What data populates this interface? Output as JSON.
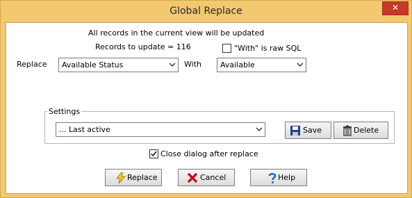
{
  "window": {
    "title": "Global Replace",
    "close_label": "✕"
  },
  "info": {
    "all_records": "All records in the current view will be updated",
    "records_to_update": "Records to update = 116"
  },
  "raw_sql": {
    "label": "\"With\" is raw SQL",
    "checked": false
  },
  "replace_row": {
    "replace_label": "Replace",
    "replace_field_value": "Available Status",
    "with_label": "With",
    "with_value": "Available"
  },
  "settings": {
    "group_label": "Settings",
    "selected": "... Last active",
    "save_label": "Save",
    "delete_label": "Delete"
  },
  "close_after": {
    "label": "Close dialog after replace",
    "checked": true
  },
  "buttons": {
    "replace_label": "Replace",
    "cancel_label": "Cancel",
    "help_label": "Help"
  },
  "colors": {
    "title_bar": "#f2c870",
    "close_button": "#c7382a"
  }
}
